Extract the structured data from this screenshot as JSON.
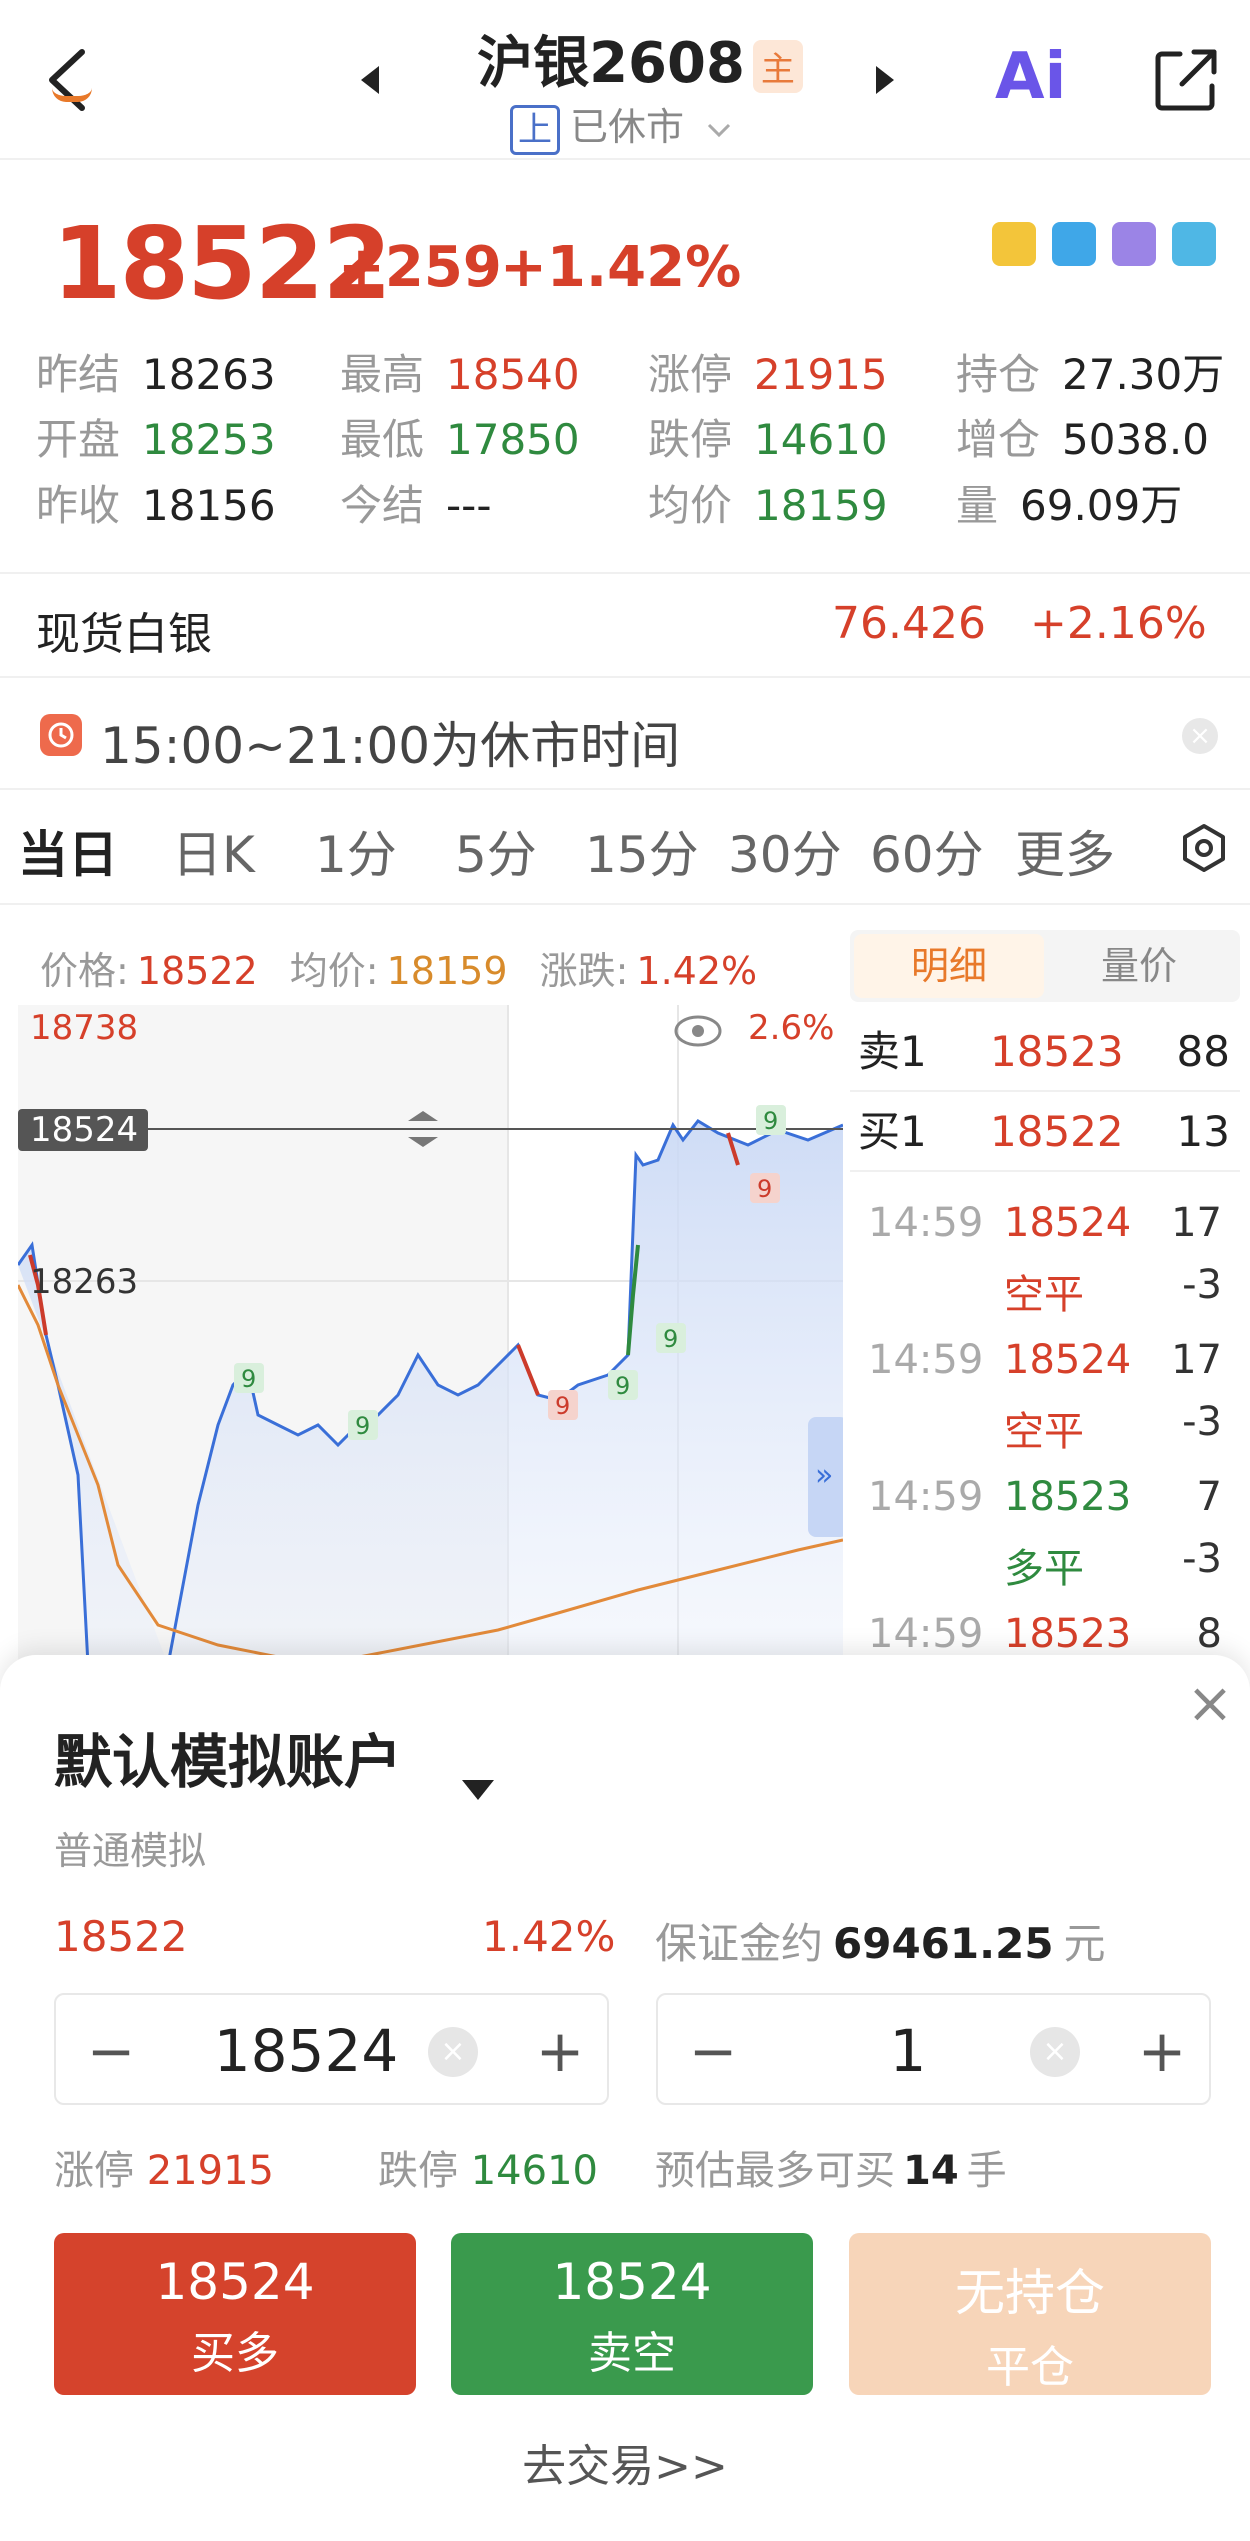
{
  "header": {
    "title": "沪银2608",
    "badge": "主",
    "exchange_tag": "上",
    "market_status": "已休市",
    "ai_label": "Ai"
  },
  "quote": {
    "price": "18522",
    "change": "+259",
    "change_pct": "+1.42%",
    "stats": [
      {
        "label": "昨结",
        "value": "18263",
        "tone": "black"
      },
      {
        "label": "最高",
        "value": "18540",
        "tone": "red"
      },
      {
        "label": "涨停",
        "value": "21915",
        "tone": "red"
      },
      {
        "label": "持仓",
        "value": "27.30万",
        "tone": "black"
      },
      {
        "label": "开盘",
        "value": "18253",
        "tone": "green"
      },
      {
        "label": "最低",
        "value": "17850",
        "tone": "green"
      },
      {
        "label": "跌停",
        "value": "14610",
        "tone": "green"
      },
      {
        "label": "增仓",
        "value": "5038.0",
        "tone": "black"
      },
      {
        "label": "昨收",
        "value": "18156",
        "tone": "black"
      },
      {
        "label": "今结",
        "value": "---",
        "tone": "black"
      },
      {
        "label": "均价",
        "value": "18159",
        "tone": "green"
      },
      {
        "label": "量",
        "value": "69.09万",
        "tone": "black"
      }
    ]
  },
  "spot": {
    "name": "现货白银",
    "price": "76.426",
    "pct": "+2.16%"
  },
  "notice": {
    "text": "15:00~21:00为休市时间",
    "close": "×"
  },
  "tabs": [
    {
      "label": "当日",
      "active": true
    },
    {
      "label": "日K",
      "active": false
    },
    {
      "label": "1分",
      "active": false
    },
    {
      "label": "5分",
      "active": false
    },
    {
      "label": "15分",
      "active": false
    },
    {
      "label": "30分",
      "active": false
    },
    {
      "label": "60分",
      "active": false
    },
    {
      "label": "更多",
      "active": false
    }
  ],
  "chart_info": {
    "price_label": "价格:",
    "price": "18522",
    "avg_label": "均价:",
    "avg": "18159",
    "chg_label": "涨跌:",
    "chg": "1.42%"
  },
  "chart_labels": {
    "top_price": "18738",
    "top_pct": "2.6%",
    "cursor_price": "18524",
    "prev_settle": "18263",
    "marker": "9"
  },
  "detail_panel": {
    "tab_detail": "明细",
    "tab_volume": "量价",
    "orderbook": [
      {
        "side": "卖1",
        "price": "18523",
        "qty": "88"
      },
      {
        "side": "买1",
        "price": "18522",
        "qty": "13"
      }
    ],
    "ticks": [
      {
        "time": "14:59",
        "price": "18524",
        "vol": "17",
        "kind": "空平",
        "delta": "-3",
        "tone": "red"
      },
      {
        "time": "14:59",
        "price": "18524",
        "vol": "17",
        "kind": "空平",
        "delta": "-3",
        "tone": "red"
      },
      {
        "time": "14:59",
        "price": "18523",
        "vol": "7",
        "kind": "多平",
        "delta": "-3",
        "tone": "green"
      },
      {
        "time": "14:59",
        "price": "18523",
        "vol": "8",
        "kind": "",
        "delta": "",
        "tone": "red"
      }
    ]
  },
  "sheet": {
    "account_name": "默认模拟账户",
    "account_type": "普通模拟",
    "price": "18522",
    "pct": "1.42%",
    "margin_label": "保证金约",
    "margin_value": "69461.25",
    "margin_unit": "元",
    "price_stepper": {
      "minus": "−",
      "value": "18524",
      "clear": "×",
      "plus": "+"
    },
    "qty_stepper": {
      "minus": "−",
      "value": "1",
      "clear": "×",
      "plus": "+"
    },
    "limit_up_label": "涨停",
    "limit_up": "21915",
    "limit_down_label": "跌停",
    "limit_down": "14610",
    "est_label": "预估最多可买",
    "est_value": "14",
    "est_unit": "手",
    "buttons": {
      "buy": {
        "price": "18524",
        "label": "买多"
      },
      "sell": {
        "price": "18524",
        "label": "卖空"
      },
      "close": {
        "price": "无持仓",
        "label": "平仓"
      }
    },
    "go_trade": "去交易>>",
    "close_icon": "×"
  },
  "colors": {
    "up": "#d6402a",
    "down": "#2f8a3f",
    "avg_line": "#e28a3a",
    "price_line": "#3a6fd8",
    "accent": "#e8792a"
  }
}
